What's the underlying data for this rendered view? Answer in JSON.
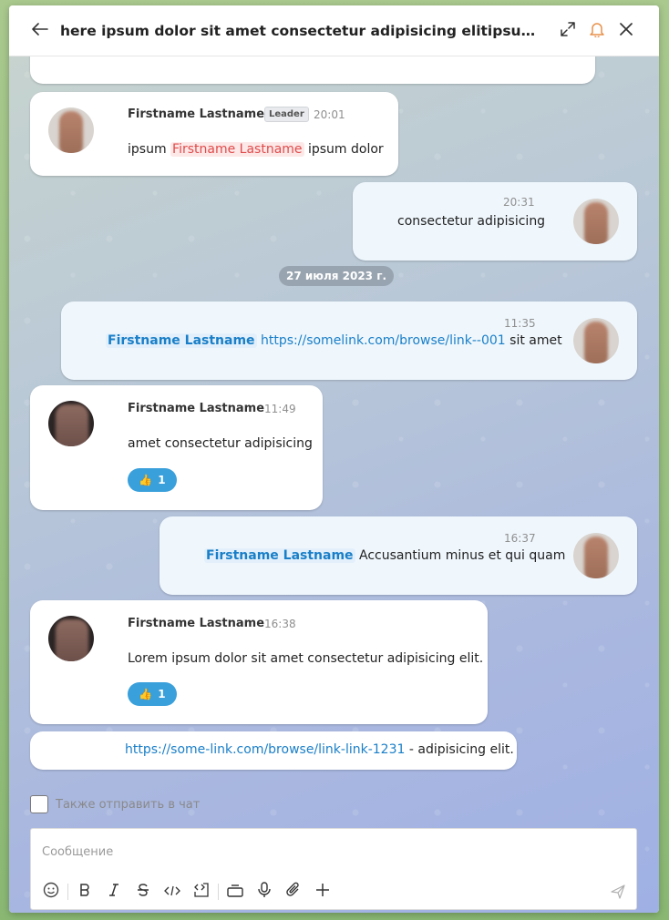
{
  "header": {
    "title": "here ipsum dolor sit amet consectetur adipisicing elitipsum dolor sit ..."
  },
  "icons": {
    "back": "arrow-left-icon",
    "expand": "expand-icon",
    "bell": "bell-icon",
    "close": "close-icon"
  },
  "colors": {
    "accent": "#1a7fc8",
    "bell": "#e8914a",
    "mention_red": "#e04b4b",
    "reaction": "#3aa0db"
  },
  "messages": {
    "m1": {
      "sender": "Firstname Lastname",
      "badge": "Leader",
      "time": "20:01",
      "text_before": "ipsum",
      "mention": "Firstname Lastname",
      "text_after": "ipsum dolor"
    },
    "m2": {
      "time": "20:31",
      "text": "consectetur adipisicing"
    },
    "date_separator": "27 июля 2023 г.",
    "m3": {
      "time": "11:35",
      "mention": "Firstname Lastname",
      "link": "https://somelink.com/browse/link--001",
      "text_after": "sit amet"
    },
    "m4": {
      "sender": "Firstname Lastname",
      "time": "11:49",
      "text": "amet consectetur adipisicing",
      "reaction_emoji": "👍",
      "reaction_count": "1"
    },
    "m5": {
      "time": "16:37",
      "mention": "Firstname Lastname",
      "text_after": "Accusantium minus et qui quam"
    },
    "m6": {
      "sender": "Firstname Lastname",
      "time": "16:38",
      "text": "Lorem ipsum dolor sit amet consectetur adipisicing elit.",
      "reaction_emoji": "👍",
      "reaction_count": "1"
    },
    "m7": {
      "link": "https://some-link.com/browse/link-link-1231",
      "text_after": "- adipisicing elit."
    }
  },
  "composer": {
    "also_send_label": "Также отправить в чат",
    "placeholder": "Сообщение"
  }
}
